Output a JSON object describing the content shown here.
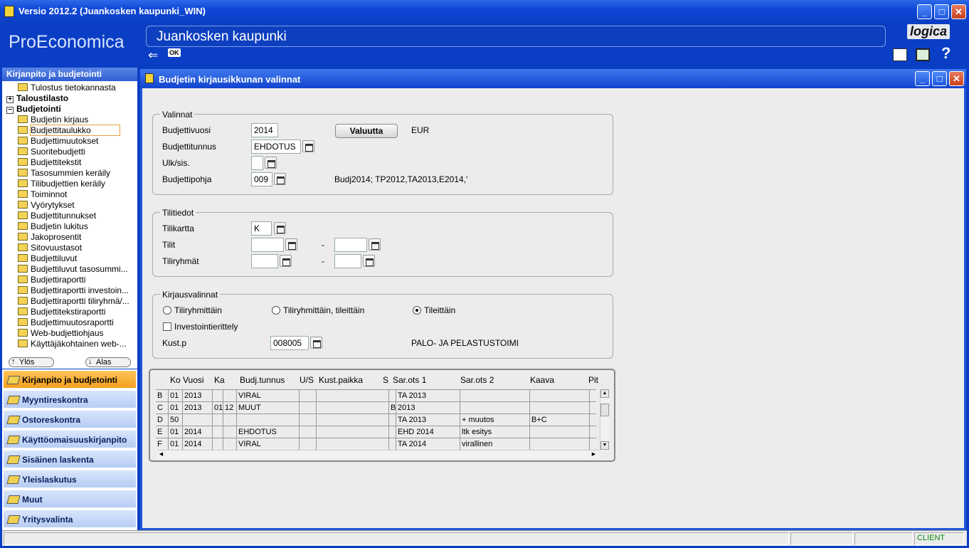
{
  "window": {
    "title": "Versio 2012.2 (Juankosken kaupunki_WIN)"
  },
  "header": {
    "brand": "ProEconomica",
    "organization": "Juankosken kaupunki",
    "logo_text": "logica",
    "ok_label": "OK",
    "help_label": "?"
  },
  "nav": {
    "header": "Kirjanpito ja budjetointi",
    "tree": [
      {
        "kind": "item",
        "label": "Tulostus tietokannasta"
      },
      {
        "kind": "group",
        "label": "Taloustilasto",
        "sign": "+"
      },
      {
        "kind": "group",
        "label": "Budjetointi",
        "sign": "−"
      },
      {
        "kind": "item",
        "label": "Budjetin kirjaus"
      },
      {
        "kind": "item",
        "label": "Budjettitaulukko",
        "selected": true
      },
      {
        "kind": "item",
        "label": "Budjettimuutokset"
      },
      {
        "kind": "item",
        "label": "Suoritebudjetti"
      },
      {
        "kind": "item",
        "label": "Budjettitekstit"
      },
      {
        "kind": "item",
        "label": "Tasosummien keräily"
      },
      {
        "kind": "item",
        "label": "Tilibudjettien keräily"
      },
      {
        "kind": "item",
        "label": "Toiminnot"
      },
      {
        "kind": "item",
        "label": "Vyörytykset"
      },
      {
        "kind": "item",
        "label": "Budjettitunnukset"
      },
      {
        "kind": "item",
        "label": "Budjetin lukitus"
      },
      {
        "kind": "item",
        "label": "Jakoprosentit"
      },
      {
        "kind": "item",
        "label": "Sitovuustasot"
      },
      {
        "kind": "item",
        "label": "Budjettiluvut"
      },
      {
        "kind": "item",
        "label": "Budjettiluvut tasosummi..."
      },
      {
        "kind": "item",
        "label": "Budjettiraportti"
      },
      {
        "kind": "item",
        "label": "Budjettiraportti investoin..."
      },
      {
        "kind": "item",
        "label": "Budjettiraportti tiliryhmä/..."
      },
      {
        "kind": "item",
        "label": "Budjettitekstiraportti"
      },
      {
        "kind": "item",
        "label": "Budjettimuutosraportti"
      },
      {
        "kind": "item",
        "label": "Web-budjettiohjaus"
      },
      {
        "kind": "item",
        "label": "Käyttäjäkohtainen web-..."
      }
    ],
    "up_label": "Ylös",
    "down_label": "Alas",
    "modules": [
      {
        "label": "Kirjanpito ja budjetointi",
        "active": true
      },
      {
        "label": "Myyntireskontra"
      },
      {
        "label": "Ostoreskontra"
      },
      {
        "label": "Käyttöomaisuuskirjanpito"
      },
      {
        "label": "Sisäinen laskenta"
      },
      {
        "label": "Yleislaskutus"
      },
      {
        "label": "Muut"
      },
      {
        "label": "Yritysvalinta"
      }
    ]
  },
  "dialog": {
    "title": "Budjetin kirjausikkunan valinnat",
    "valinnat": {
      "legend": "Valinnat",
      "budjettivuosi_label": "Budjettivuosi",
      "budjettivuosi": "2014",
      "valuutta_button": "Valuutta",
      "currency": "EUR",
      "budjettitunnus_label": "Budjettitunnus",
      "budjettitunnus": "EHDOTUS",
      "ulksis_label": "Ulk/sis.",
      "ulksis": "",
      "budjettipohja_label": "Budjettipohja",
      "budjettipohja": "009",
      "budjettipohja_desc": "Budj2014; TP2012,TA2013,E2014,'"
    },
    "tilitiedot": {
      "legend": "Tilitiedot",
      "tilikartta_label": "Tilikartta",
      "tilikartta": "K",
      "tilit_label": "Tilit",
      "tilit_from": "",
      "tilit_to": "",
      "tiliryhmat_label": "Tiliryhmät",
      "tiliryhmat_from": "",
      "tiliryhmat_to": "",
      "dash": "-"
    },
    "kirjausvalinnat": {
      "legend": "Kirjausvalinnat",
      "radio_tiliryhmittain": "Tiliryhmittäin",
      "radio_tiliryhmittain_tileittain": "Tiliryhmittäin, tileittäin",
      "radio_tileittain": "Tileittäin",
      "selected_radio": "Tileittäin",
      "check_investointierittely": "Investointierittely",
      "investointierittely_checked": false,
      "kustp_label": "Kust.p",
      "kustp": "008005",
      "kustp_desc": "PALO- JA PELASTUSTOIMI"
    },
    "grid": {
      "headers": [
        "Ko",
        "Vuosi",
        "Ka",
        "Budj.tunnus",
        "U/S",
        "Kust.paikka",
        "S",
        "Sar.ots 1",
        "Sar.ots 2",
        "Kaava",
        "Pit"
      ],
      "rows": [
        [
          "B",
          "01",
          "2013",
          "",
          "",
          "VIRAL",
          "",
          "",
          "",
          "TA 2013",
          "",
          ""
        ],
        [
          "C",
          "01",
          "2013",
          "01",
          "12",
          "MUUT",
          "",
          "",
          "Bu-muutos",
          "2013",
          "",
          ""
        ],
        [
          "D",
          "50",
          "",
          "",
          "",
          "",
          "",
          "",
          "",
          "TA 2013",
          "+  muutos",
          "B+C"
        ],
        [
          "E",
          "01",
          "2014",
          "",
          "",
          "EHDOTUS",
          "",
          "",
          "",
          "EHD 2014",
          "ltk esitys",
          ""
        ],
        [
          "F",
          "01",
          "2014",
          "",
          "",
          "VIRAL",
          "",
          "",
          "",
          "TA 2014",
          "virallinen",
          ""
        ]
      ]
    }
  },
  "status": {
    "client": "CLIENT"
  }
}
